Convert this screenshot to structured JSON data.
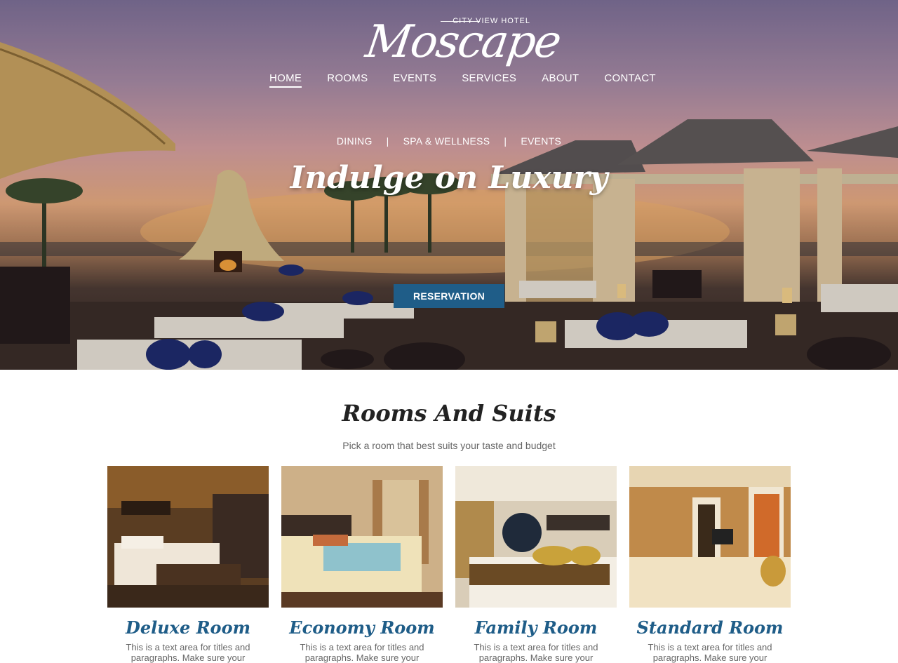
{
  "brand": {
    "name": "Moscape",
    "tagline": "CITY VIEW HOTEL"
  },
  "nav": {
    "items": [
      {
        "label": "HOME",
        "active": true
      },
      {
        "label": "ROOMS"
      },
      {
        "label": "EVENTS"
      },
      {
        "label": "SERVICES"
      },
      {
        "label": "ABOUT"
      },
      {
        "label": "CONTACT"
      }
    ]
  },
  "hero": {
    "sublinks": [
      "DINING",
      "SPA & WELLNESS",
      "EVENTS"
    ],
    "separator": "|",
    "headline": "Indulge on Luxury",
    "cta": "RESERVATION",
    "cta_color": "#1f5d88"
  },
  "rooms": {
    "title": "Rooms And Suits",
    "subtitle": "Pick a room that best suits your taste and budget",
    "accent": "#1f5d88",
    "items": [
      {
        "title": "Deluxe Room",
        "desc": "This is a text area for titles and paragraphs. Make sure your titles"
      },
      {
        "title": "Economy Room",
        "desc": "This is a text area for titles and paragraphs. Make sure your titles"
      },
      {
        "title": "Family Room",
        "desc": "This is a text area for titles and paragraphs. Make sure your titles"
      },
      {
        "title": "Standard Room",
        "desc": "This is a text area for titles and paragraphs. Make sure your titles"
      }
    ]
  }
}
